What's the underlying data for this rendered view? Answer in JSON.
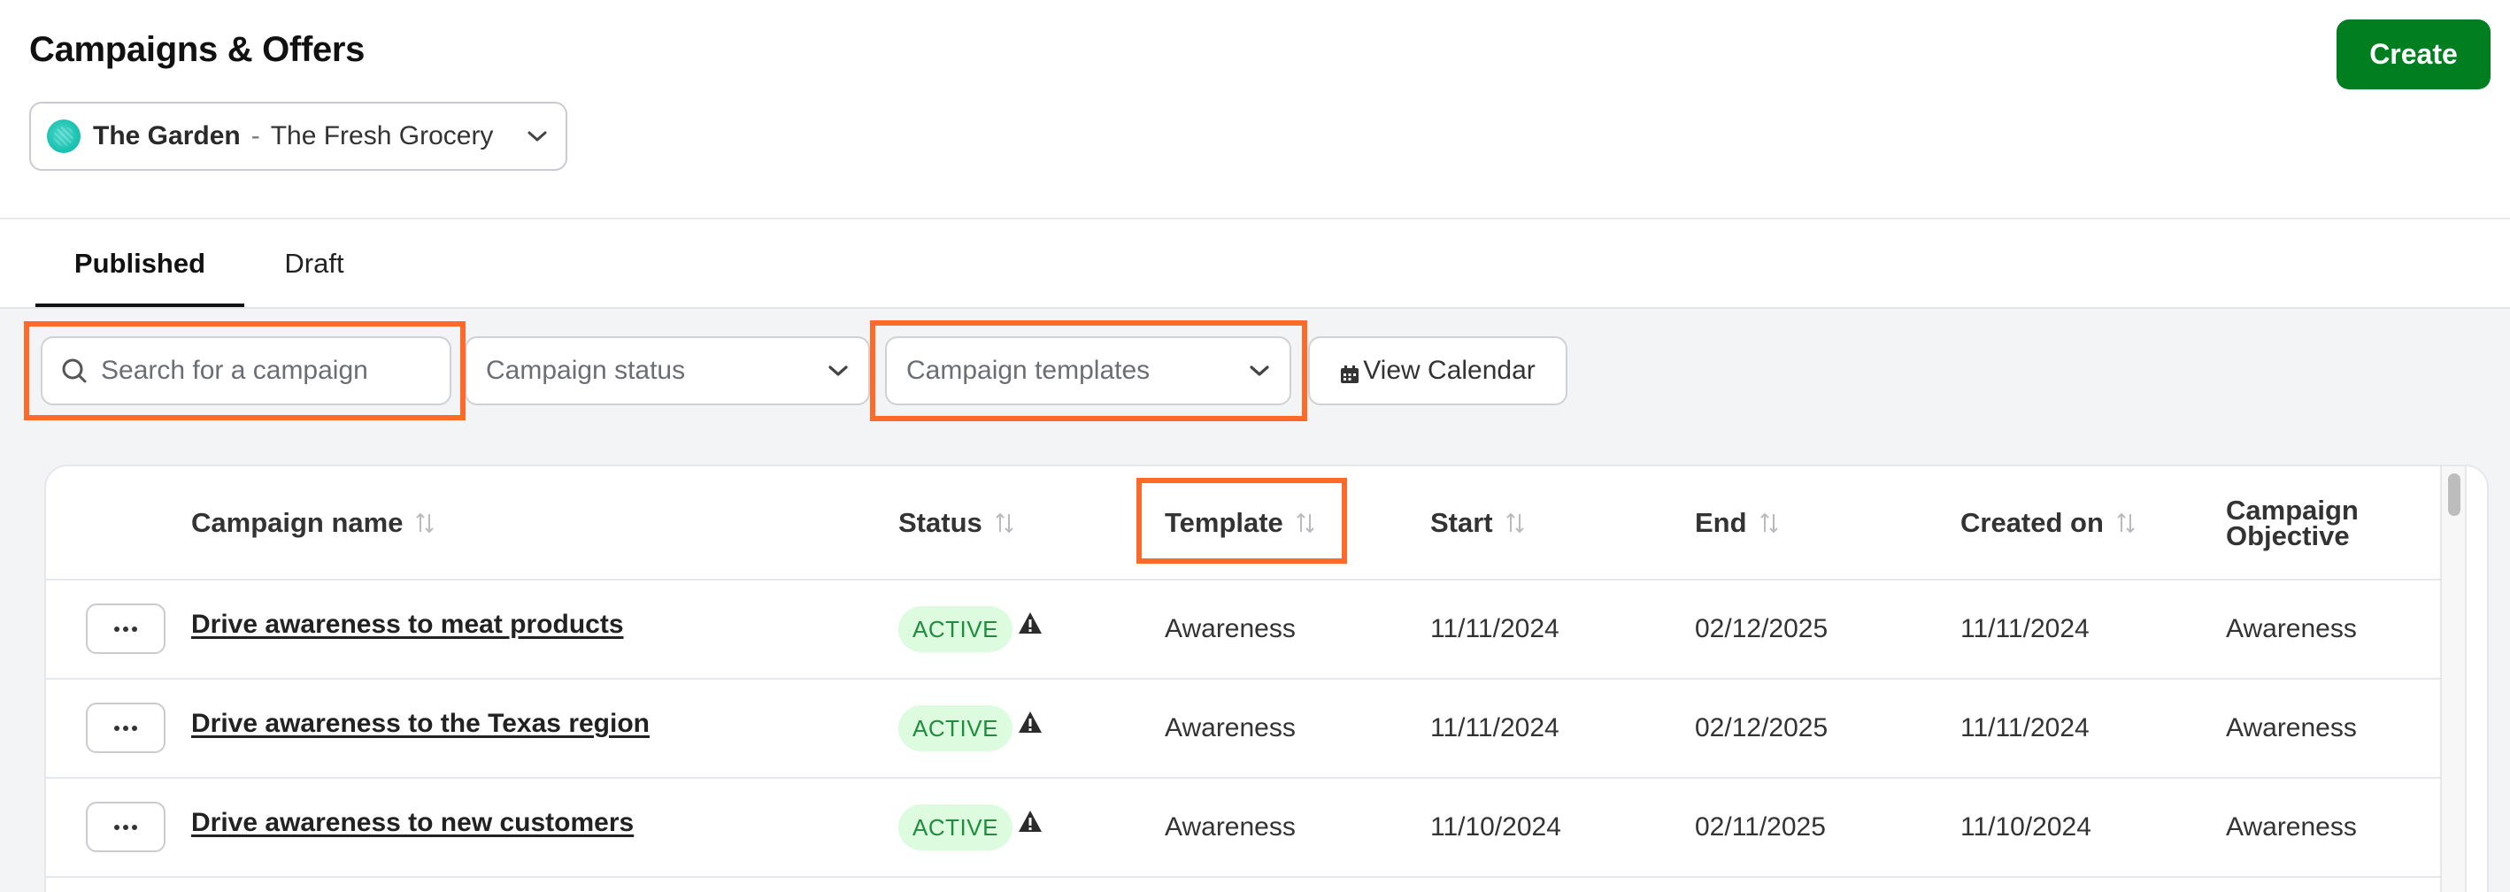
{
  "page": {
    "title": "Campaigns & Offers",
    "create_label": "Create",
    "brand_color": "#017E1F",
    "highlight_color": "#FF6A2A"
  },
  "store_selector": {
    "name": "The Garden",
    "separator": "-",
    "subname": "The Fresh Grocery",
    "avatar_icon": "store-avatar-icon",
    "chevron_icon": "chevron-down-icon"
  },
  "tabs": [
    {
      "label": "Published",
      "active": true
    },
    {
      "label": "Draft",
      "active": false
    }
  ],
  "filters": {
    "search_placeholder": "Search for a campaign",
    "search_value": "",
    "status_placeholder": "Campaign status",
    "templates_placeholder": "Campaign templates",
    "calendar_label": "View Calendar",
    "calendar_icon": "calendar-icon"
  },
  "table": {
    "columns": [
      {
        "key": "name",
        "label": "Campaign name",
        "sortable": true
      },
      {
        "key": "status",
        "label": "Status",
        "sortable": true
      },
      {
        "key": "template",
        "label": "Template",
        "sortable": true
      },
      {
        "key": "start",
        "label": "Start",
        "sortable": true
      },
      {
        "key": "end",
        "label": "End",
        "sortable": true
      },
      {
        "key": "created",
        "label": "Created on",
        "sortable": true
      },
      {
        "key": "objective",
        "label": "Campaign Objective",
        "sortable": false
      }
    ],
    "objective_label_line1": "Campaign",
    "objective_label_line2": "Objective",
    "rows": [
      {
        "name": "Drive awareness to meat products",
        "status": "ACTIVE",
        "warning": true,
        "template": "Awareness",
        "start": "11/11/2024",
        "end": "02/12/2025",
        "created": "11/11/2024",
        "objective": "Awareness"
      },
      {
        "name": "Drive awareness to the Texas region",
        "status": "ACTIVE",
        "warning": true,
        "template": "Awareness",
        "start": "11/11/2024",
        "end": "02/12/2025",
        "created": "11/11/2024",
        "objective": "Awareness"
      },
      {
        "name": "Drive awareness to new customers",
        "status": "ACTIVE",
        "warning": true,
        "template": "Awareness",
        "start": "11/10/2024",
        "end": "02/11/2025",
        "created": "11/10/2024",
        "objective": "Awareness"
      }
    ],
    "status_colors": {
      "active_bg": "#DCFBDF",
      "active_text": "#1E8E3E"
    }
  }
}
